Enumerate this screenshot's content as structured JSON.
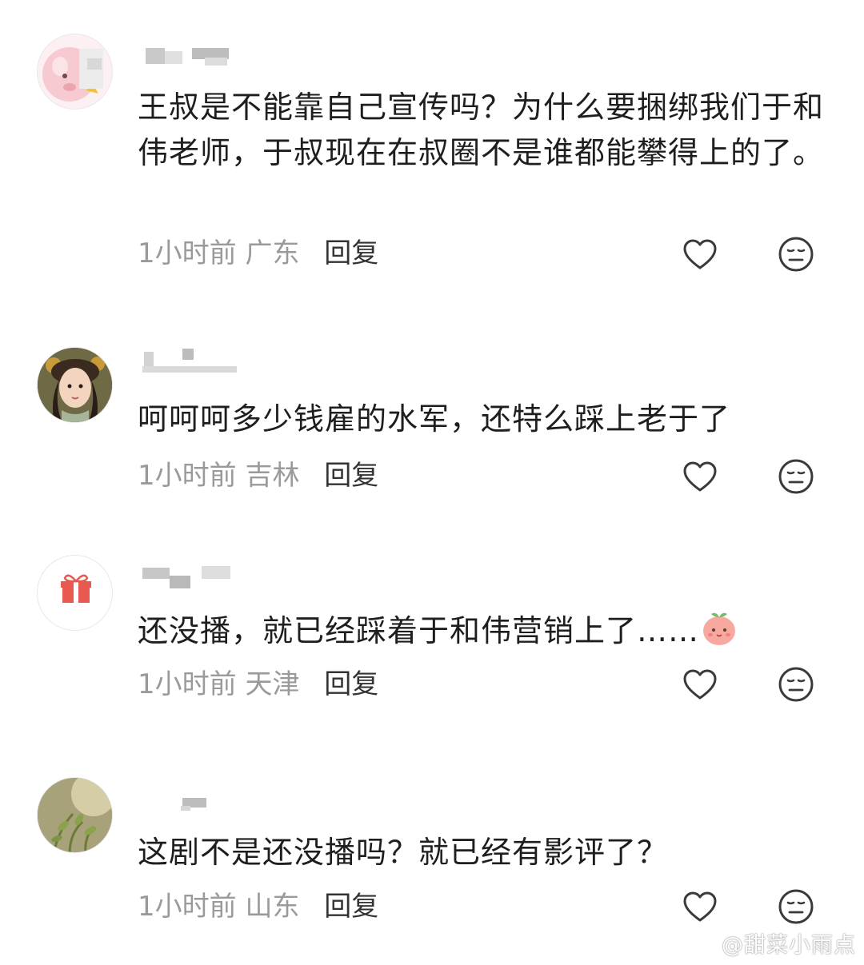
{
  "comments": [
    {
      "text": "王叔是不能靠自己宣传吗？为什么要捆绑我们于和伟老师，于叔现在在叔圈不是谁都能攀得上的了。",
      "time": "1小时前",
      "location": "广东",
      "reply": "回复"
    },
    {
      "text": "呵呵呵多少钱雇的水军，还特么踩上老于了",
      "time": "1小时前",
      "location": "吉林",
      "reply": "回复"
    },
    {
      "text": "还没播，就已经踩着于和伟营销上了……",
      "time": "1小时前",
      "location": "天津",
      "reply": "回复"
    },
    {
      "text": "这剧不是还没播吗？就已经有影评了？",
      "time": "1小时前",
      "location": "山东",
      "reply": "回复"
    }
  ],
  "watermark": "@甜菜小雨点",
  "icons": {
    "like": "heart-outline-icon",
    "dislike": "meh-face-icon",
    "inline_emoji": "peach-emoji-icon",
    "watermark_logo": "weibo-logo-icon"
  }
}
